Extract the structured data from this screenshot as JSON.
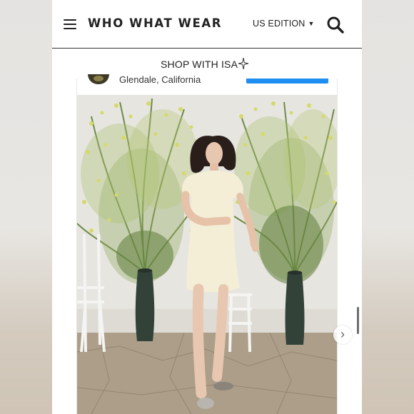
{
  "header": {
    "menu_icon": "hamburger-menu-icon",
    "logo": "WHO WHAT WEAR",
    "edition": "US EDITION",
    "edition_caret": "▼",
    "search_icon": "search-icon"
  },
  "shop": {
    "label": "SHOP WITH ISA",
    "icon": "sparkle-icon"
  },
  "post": {
    "location": "Glendale, California",
    "next_icon": "›"
  },
  "colors": {
    "accent_blue": "#1f8ef1",
    "text": "#222222",
    "dress": "#f4eed6",
    "pot": "#3a4a40",
    "foliage": "#7f9a4e",
    "blossom": "#d6da6e"
  }
}
